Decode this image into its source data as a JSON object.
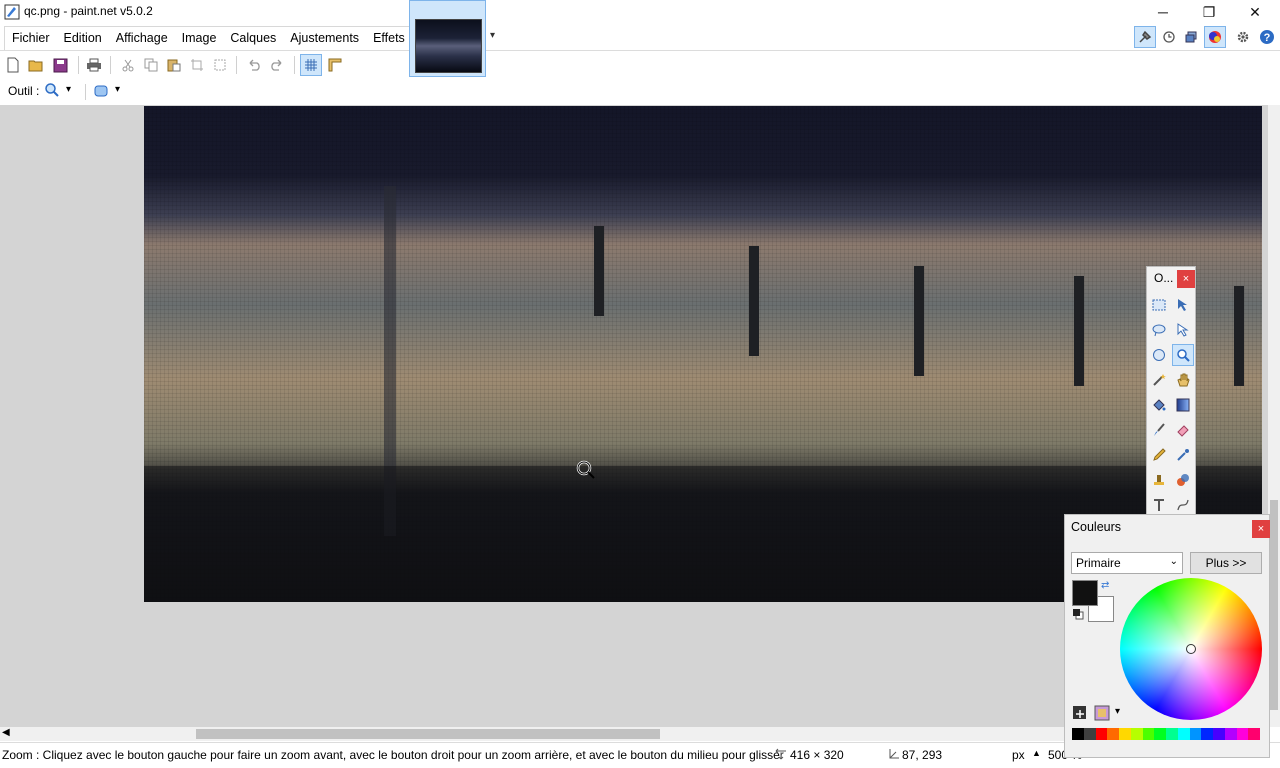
{
  "window": {
    "title": "qc.png - paint.net v5.0.2",
    "minimize_glyph": "─",
    "maximize_glyph": "❐",
    "close_glyph": "✕"
  },
  "menu": {
    "items": [
      "Fichier",
      "Edition",
      "Affichage",
      "Image",
      "Calques",
      "Ajustements",
      "Effets"
    ]
  },
  "toolbar": {
    "icons": [
      "new-icon",
      "open-icon",
      "save-icon",
      "print-icon",
      "cut-icon",
      "copy-icon",
      "paste-icon",
      "crop-icon",
      "deselect-icon",
      "undo-icon",
      "redo-icon",
      "grid-icon",
      "ruler-icon"
    ]
  },
  "tool_row": {
    "label": "Outil :",
    "tool_icon": "zoom-icon",
    "dropdown_glyph": "▾"
  },
  "tools_window": {
    "title": "O...",
    "close_glyph": "×",
    "selected": "zoom"
  },
  "colors_window": {
    "title": "Couleurs",
    "close_glyph": "×",
    "mode": "Primaire",
    "more_label": "Plus >>",
    "primary_color": "#111111",
    "secondary_color": "#ffffff"
  },
  "status": {
    "hint": "Zoom : Cliquez avec le bouton gauche pour faire un zoom avant, avec le bouton droit pour un zoom arrière, et avec le bouton du milieu pour glisser",
    "image_size": "416 × 320",
    "cursor_pos": "87, 293",
    "unit": "px",
    "zoom": "500 %"
  },
  "colors": {
    "accent": "#7eb4ea",
    "selected_bg": "#cfe6fb"
  }
}
